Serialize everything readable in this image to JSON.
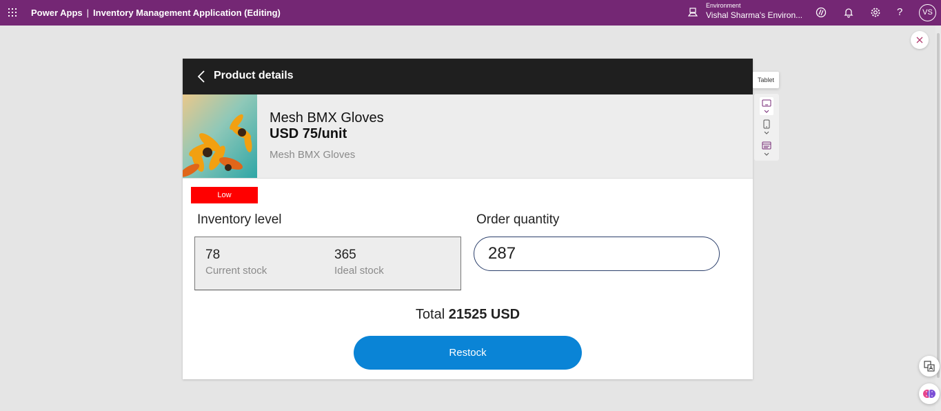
{
  "topbar": {
    "app_name": "Power Apps",
    "separator": "|",
    "document_title": "Inventory Management Application (Editing)",
    "environment_label": "Environment",
    "environment_name": "Vishal Sharma's Environ...",
    "help_label": "?",
    "avatar_initials": "VS"
  },
  "app": {
    "header_title": "Product details",
    "product": {
      "name": "Mesh BMX Gloves",
      "price": "USD 75/unit",
      "subtitle": "Mesh BMX Gloves"
    },
    "stock_badge": "Low",
    "stock_badge_color": "#ff0000",
    "inventory_label": "Inventory level",
    "order_label": "Order quantity",
    "current_stock": "78",
    "current_stock_caption": "Current stock",
    "ideal_stock": "365",
    "ideal_stock_caption": "Ideal stock",
    "order_quantity": "287",
    "total_prefix": "Total",
    "total_value": "21525 USD",
    "restock_label": "Restock"
  },
  "device_toolbar": {
    "tooltip": "Tablet",
    "options": [
      "tablet-icon",
      "phone-icon",
      "web-icon"
    ]
  },
  "colors": {
    "topbar": "#742774",
    "app_header": "#1f1f1f",
    "primary_button": "#0a84d6"
  }
}
